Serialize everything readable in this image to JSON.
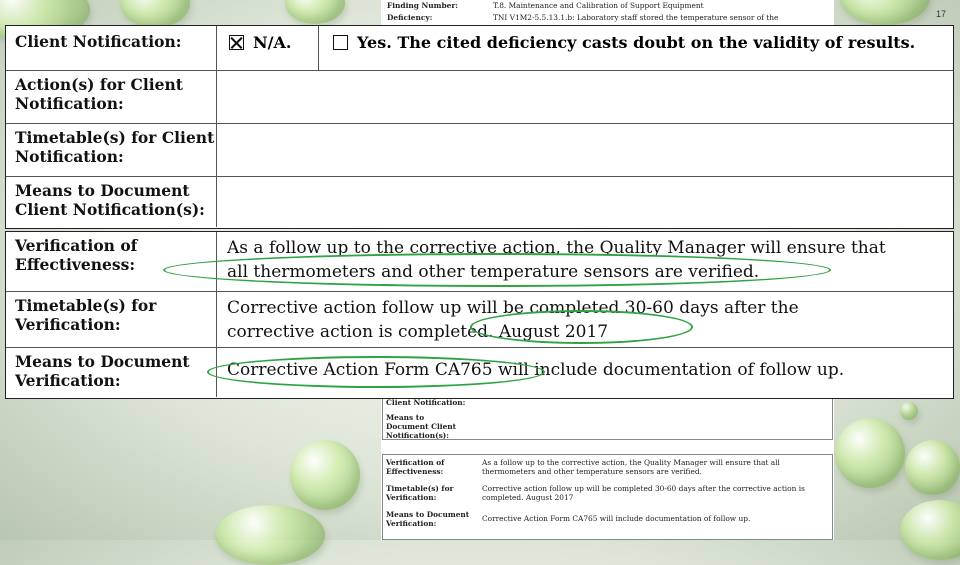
{
  "slide_number": "17",
  "background_doc_top": [
    {
      "label": "Finding Number:",
      "value": "T.8. Maintenance and Calibration of Support Equipment"
    },
    {
      "label": "Deficiency:",
      "value": "TNI V1M2-5.5.13.1.b: Laboratory staff stored the temperature sensor of the"
    }
  ],
  "client_table": {
    "notification_label": "Client Notification:",
    "option_na": "N/A.",
    "option_na_checked": true,
    "option_yes": "Yes.  The cited deficiency casts doubt on the validity of results.",
    "option_yes_checked": false,
    "action_label": "Action(s) for Client Notification:",
    "timetable_label": "Timetable(s) for Client Notification:",
    "means_label": "Means to Document Client Notification(s):"
  },
  "verification_table": {
    "verification_label": "Verification of Effectiveness:",
    "verification_line1": "As a follow up to the corrective action, the Quality Manager will ensure that",
    "verification_line2": "all thermometers and other temperature sensors are verified.",
    "timetable_label": "Timetable(s) for Verification:",
    "timetable_line1": "Corrective action follow up will be completed 30-60 days after the",
    "timetable_line2": "corrective action is completed. August 2017",
    "means_label": "Means to Document Verification:",
    "means_text": "Corrective Action Form CA765 will include documentation of follow up."
  },
  "background_doc_bottom": {
    "client_notification_fragment": "Client Notification:",
    "means_client": "Means to Document Client Notification(s):",
    "verification_label": "Verification of Effectiveness:",
    "verification_text": "As a follow up to the corrective action, the Quality Manager will ensure that all thermometers and other temperature sensors are verified.",
    "timetable_label": "Timetable(s) for Verification:",
    "timetable_text": "Corrective action follow up will be completed 30-60 days after the corrective action is completed. August 2017",
    "means_label": "Means to Document Verification:",
    "means_text": "Corrective Action Form CA765 will include documentation of follow up."
  },
  "highlight_color": "#2fa344"
}
